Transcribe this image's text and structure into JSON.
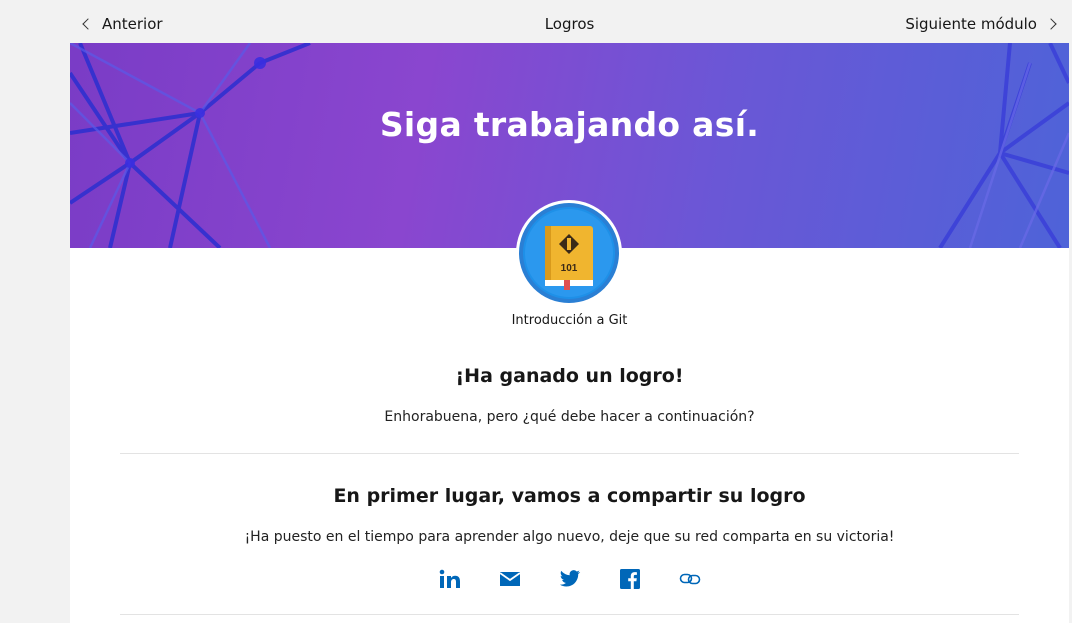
{
  "nav": {
    "previous_label": "Anterior",
    "title": "Logros",
    "next_label": "Siguiente módulo"
  },
  "hero": {
    "heading": "Siga trabajando así."
  },
  "badge": {
    "number": "101",
    "label": "Introducción a Git",
    "icon": "git-book-icon"
  },
  "achievement": {
    "title": "¡Ha ganado un logro!",
    "subtitle": "Enhorabuena, pero ¿qué debe hacer a continuación?"
  },
  "share": {
    "title": "En primer lugar, vamos a compartir su logro",
    "subtitle": "¡Ha puesto en el tiempo para aprender algo nuevo, deje que su red comparta en su victoria!",
    "icons": [
      "linkedin-icon",
      "email-icon",
      "twitter-icon",
      "facebook-icon",
      "link-icon"
    ]
  },
  "colors": {
    "accent": "#0067b8",
    "hero_start": "#7a3cc6",
    "hero_end": "#4e63d8"
  }
}
